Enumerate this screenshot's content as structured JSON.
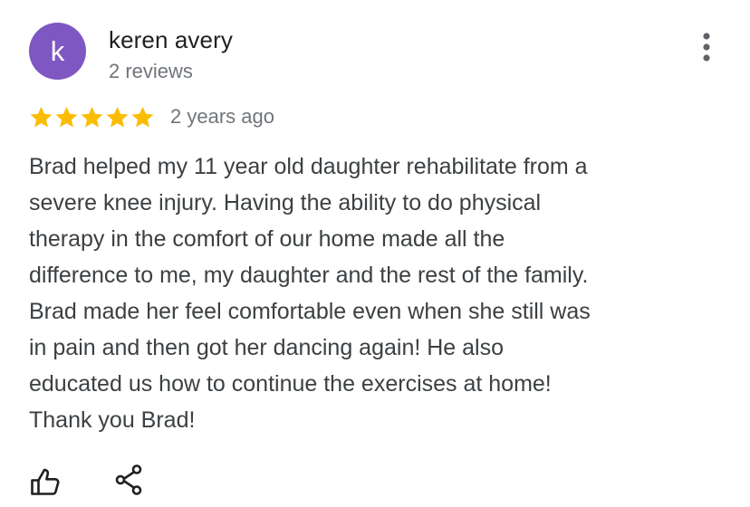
{
  "colors": {
    "avatar_bg": "#7e57c2",
    "star": "#fbbc04"
  },
  "review": {
    "avatar_letter": "k",
    "author_name": "keren avery",
    "review_count": "2 reviews",
    "rating": 5,
    "rating_max": 5,
    "date": "2 years ago",
    "text": "Brad helped my 11 year old daughter rehabilitate from a\nsevere knee injury. Having the ability to do physical\ntherapy in the comfort of our home made all the\ndifference to me, my daughter and the rest of the family.\nBrad made her feel comfortable even when she still was\nin pain and  then got her dancing again! He also\neducated us how to continue the exercises at home!\nThank you Brad!"
  },
  "icons": {
    "more": "more-vert-icon",
    "star": "star-icon",
    "like": "thumb-up-icon",
    "share": "share-icon"
  }
}
